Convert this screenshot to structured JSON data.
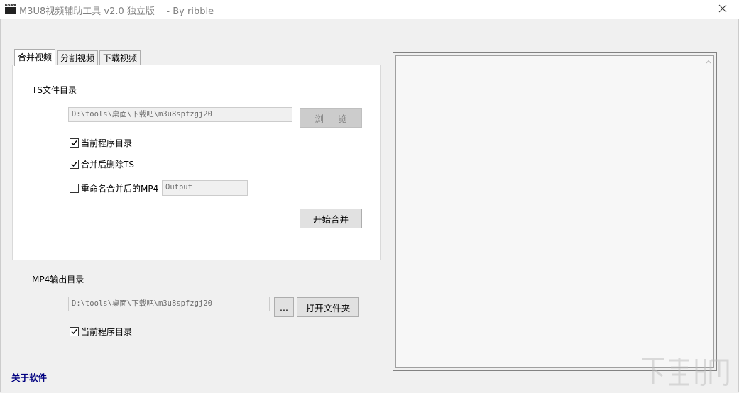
{
  "window": {
    "title": "M3U8视频辅助工具 v2.0 独立版    - By ribble"
  },
  "tabs": [
    {
      "label": "合并视频",
      "active": true
    },
    {
      "label": "分割视频",
      "active": false
    },
    {
      "label": "下载视频",
      "active": false
    }
  ],
  "merge": {
    "ts_dir_label": "TS文件目录",
    "ts_dir_value": "D:\\tools\\桌面\\下载吧\\m3u8spfzgj20",
    "browse_label": "浏 览",
    "current_dir_label": "当前程序目录",
    "current_dir_checked": true,
    "delete_ts_label": "合并后删除TS",
    "delete_ts_checked": true,
    "rename_label": "重命名合并后的MP4",
    "rename_checked": false,
    "rename_value": "Output",
    "start_label": "开始合并"
  },
  "output": {
    "label": "MP4输出目录",
    "dir_value": "D:\\tools\\桌面\\下载吧\\m3u8spfzgj20",
    "dots_label": "...",
    "open_folder_label": "打开文件夹",
    "current_dir_label": "当前程序目录",
    "current_dir_checked": true
  },
  "footer": {
    "about_label": "关于软件"
  },
  "colors": {
    "about_link": "#000080",
    "window_bg": "#f0f0f0"
  }
}
